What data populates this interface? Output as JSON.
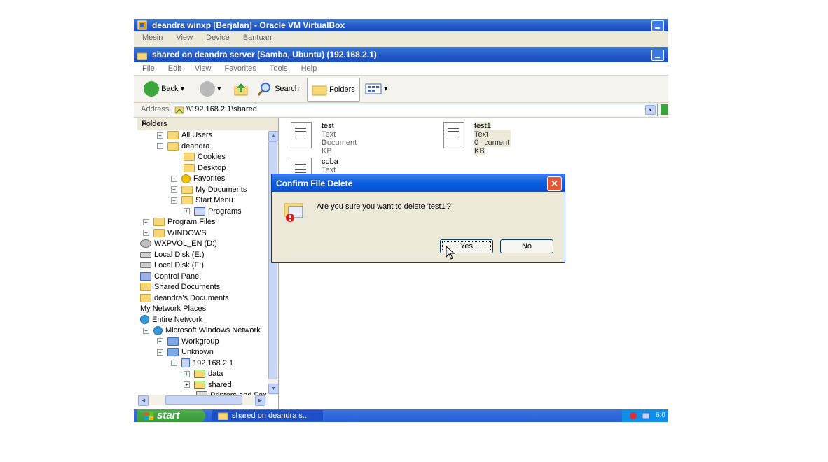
{
  "vbox": {
    "title": "deandra winxp [Berjalan] - Oracle VM VirtualBox",
    "menu": [
      "Mesin",
      "View",
      "Device",
      "Bantuan"
    ]
  },
  "explorer": {
    "title": "shared on deandra server (Samba, Ubuntu) (192.168.2.1)",
    "menu": [
      "File",
      "Edit",
      "View",
      "Favorites",
      "Tools",
      "Help"
    ],
    "toolbar": {
      "back": "Back",
      "search": "Search",
      "folders": "Folders"
    },
    "address": {
      "label": "Address",
      "value": "\\\\192.168.2.1\\shared"
    },
    "folders_pane": {
      "header": "Folders",
      "close": "×",
      "tree": [
        {
          "label": "All Users",
          "exp": "+",
          "icon": "folder"
        },
        {
          "label": "deandra",
          "exp": "−",
          "icon": "folder"
        },
        {
          "label": "Cookies",
          "exp": "",
          "icon": "folder"
        },
        {
          "label": "Desktop",
          "exp": "",
          "icon": "folder"
        },
        {
          "label": "Favorites",
          "exp": "+",
          "icon": "star"
        },
        {
          "label": "My Documents",
          "exp": "+",
          "icon": "folder"
        },
        {
          "label": "Start Menu",
          "exp": "−",
          "icon": "folder"
        },
        {
          "label": "Programs",
          "exp": "+",
          "icon": "programs"
        },
        {
          "label": "Program Files",
          "exp": "+",
          "icon": "folder"
        },
        {
          "label": "WINDOWS",
          "exp": "+",
          "icon": "folder"
        },
        {
          "label": "WXPVOL_EN (D:)",
          "exp": "",
          "icon": "cd"
        },
        {
          "label": "Local Disk (E:)",
          "exp": "",
          "icon": "disk"
        },
        {
          "label": "Local Disk (F:)",
          "exp": "",
          "icon": "disk"
        },
        {
          "label": "Control Panel",
          "exp": "",
          "icon": "control"
        },
        {
          "label": "Shared Documents",
          "exp": "",
          "icon": "folder"
        },
        {
          "label": "deandra's Documents",
          "exp": "",
          "icon": "folder"
        },
        {
          "label": "My Network Places",
          "exp": "",
          "icon": "none"
        },
        {
          "label": "Entire Network",
          "exp": "",
          "icon": "globe"
        },
        {
          "label": "Microsoft Windows Network",
          "exp": "−",
          "icon": "globe"
        },
        {
          "label": "Workgroup",
          "exp": "+",
          "icon": "network"
        },
        {
          "label": "Unknown",
          "exp": "−",
          "icon": "network"
        },
        {
          "label": "192.168.2.1",
          "exp": "−",
          "icon": "computer"
        },
        {
          "label": "data",
          "exp": "+",
          "icon": "share"
        },
        {
          "label": "shared",
          "exp": "+",
          "icon": "share"
        },
        {
          "label": "Printers and Faxes",
          "exp": "",
          "icon": "printer"
        }
      ]
    },
    "files": [
      {
        "name": "test",
        "type": "Text Document",
        "size": "0 KB"
      },
      {
        "name": "test1",
        "type": "Text Document",
        "size": "0 KB"
      },
      {
        "name": "coba",
        "type": "Text Document",
        "size": ""
      }
    ]
  },
  "dialog": {
    "title": "Confirm File Delete",
    "message": "Are you sure you want to delete 'test1'?",
    "yes": "Yes",
    "no": "No"
  },
  "taskbar": {
    "start": "start",
    "task": "shared on deandra s...",
    "clock": "6:0"
  }
}
